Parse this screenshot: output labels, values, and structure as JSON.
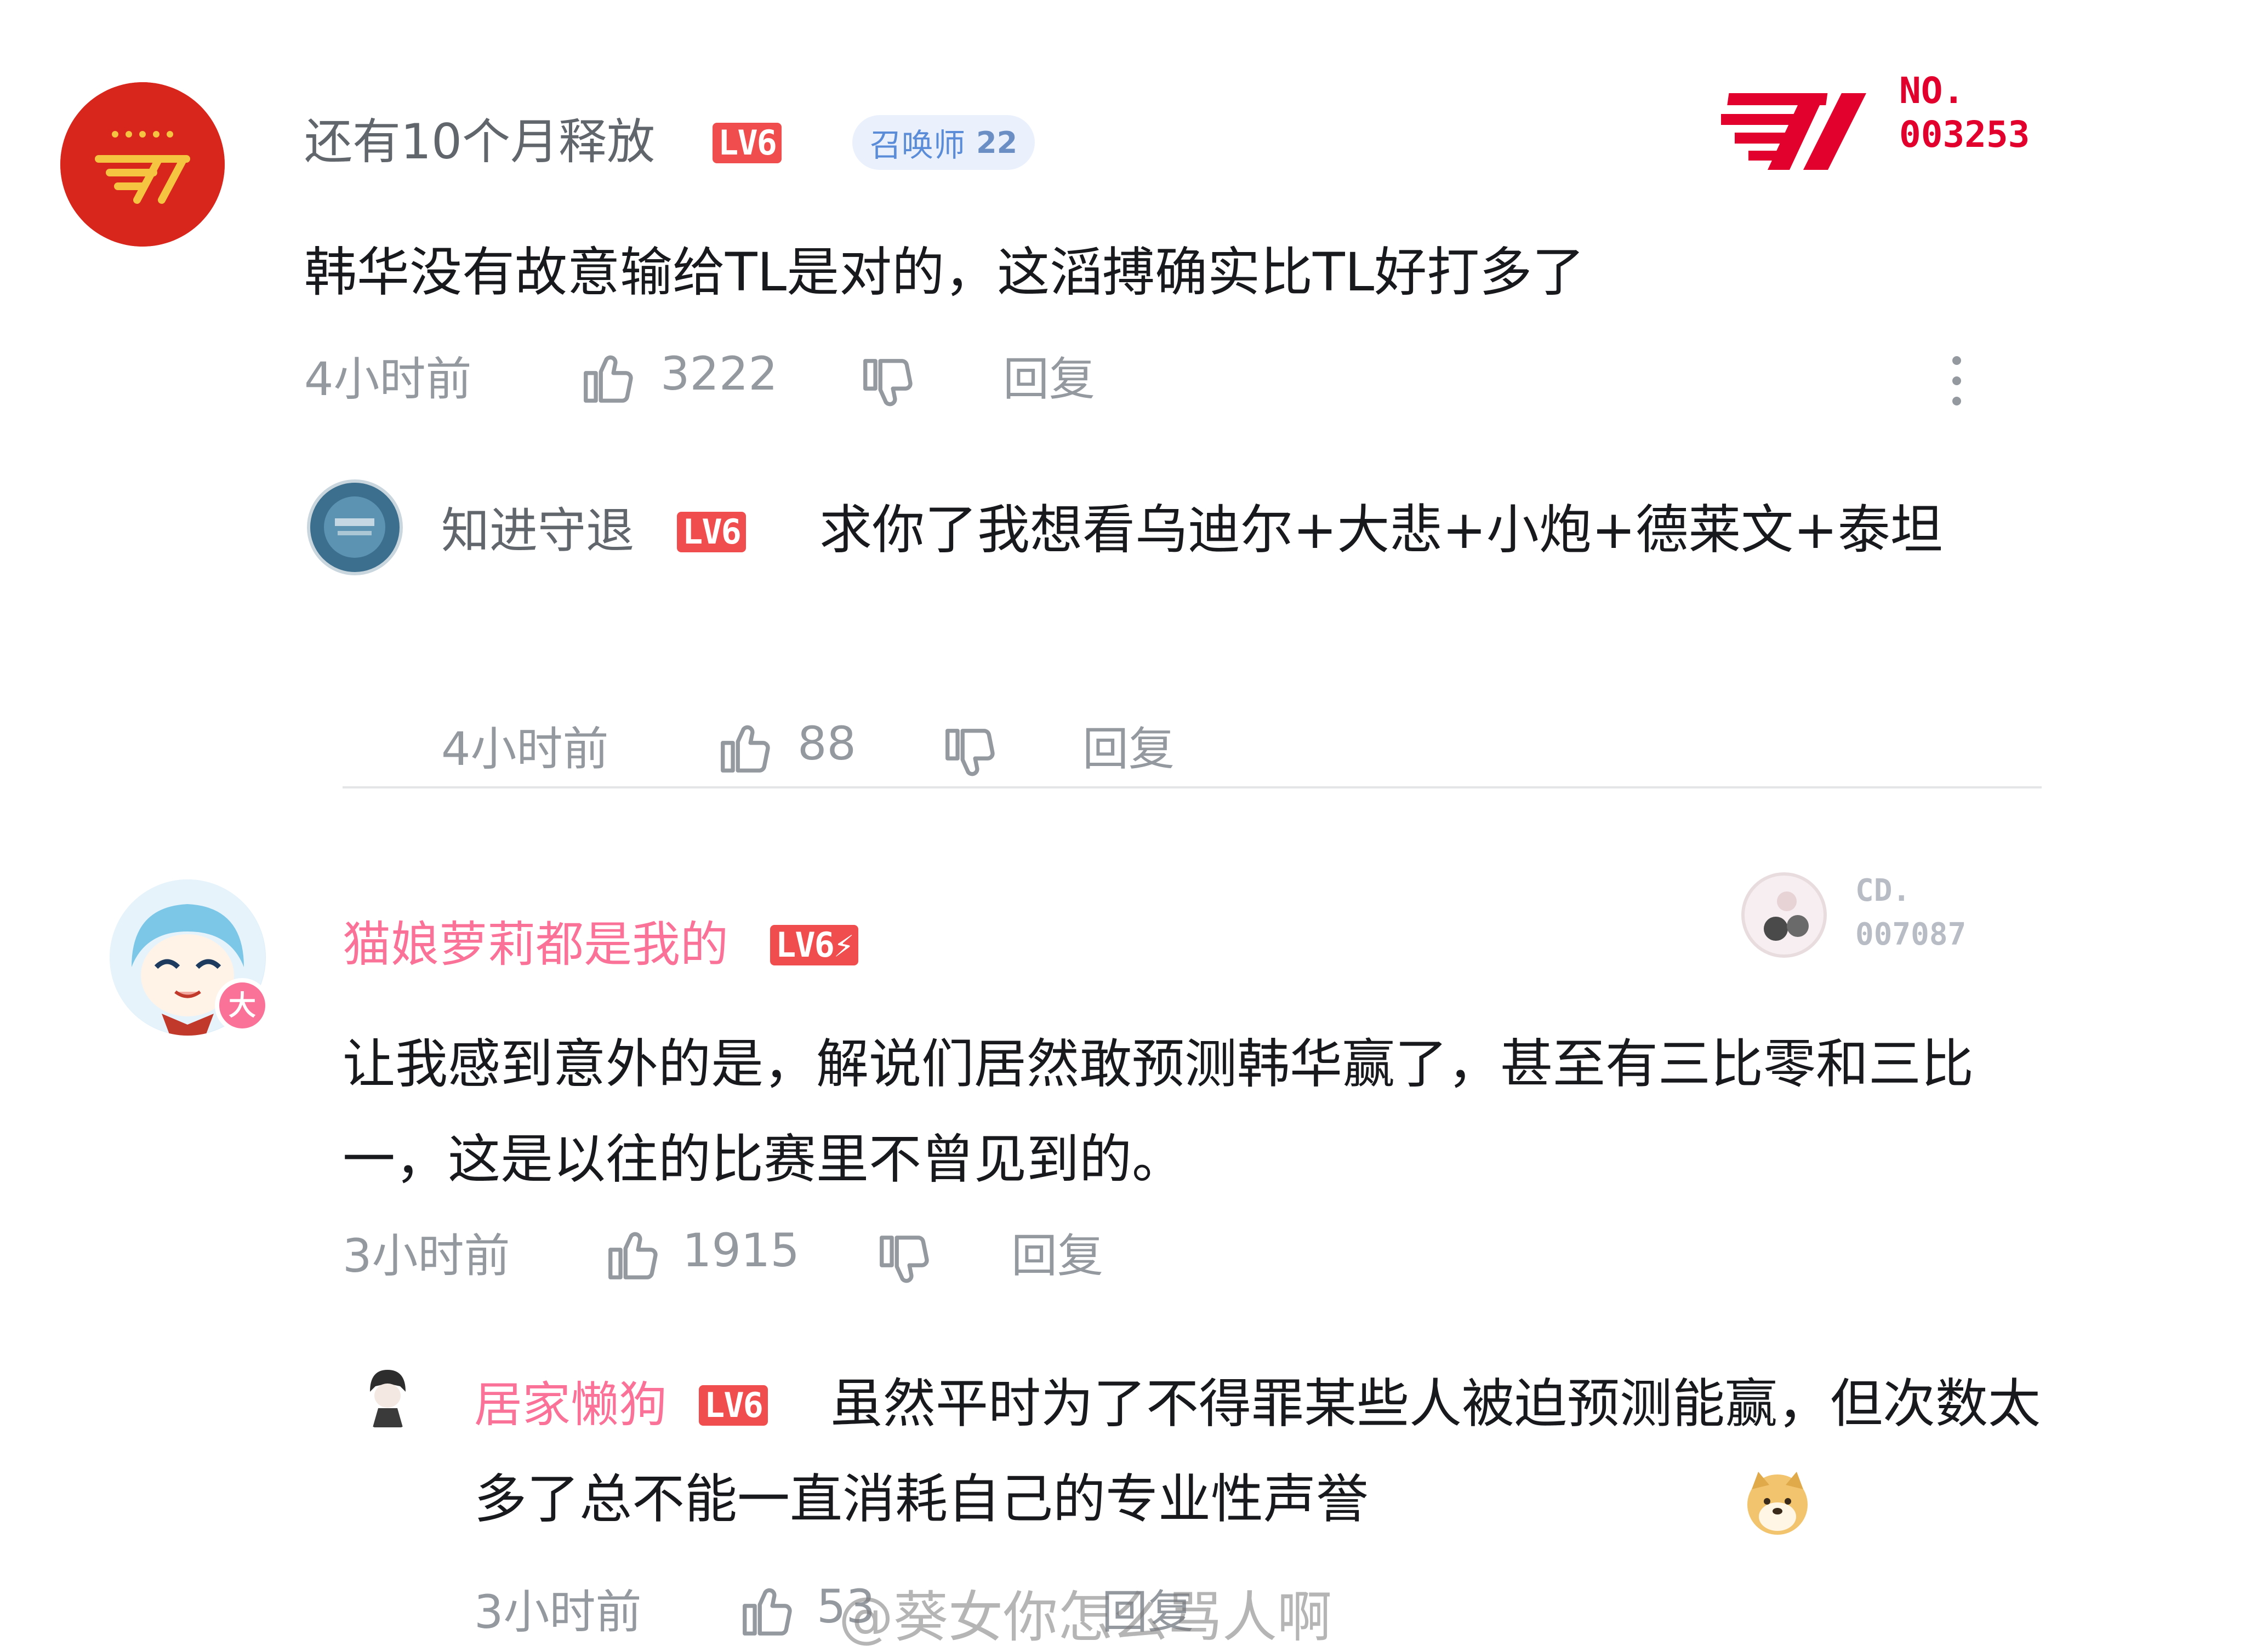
{
  "comments": [
    {
      "username": "还有10个月释放",
      "level": "LV6",
      "badge_label": "召唤师",
      "badge_level": "22",
      "fan_card": {
        "label": "NO.",
        "number": "003253"
      },
      "content": "韩华没有故意输给TL是对的，这滔搏确实比TL好打多了",
      "time": "4小时前",
      "likes": "3222",
      "reply_label": "回复",
      "reply": {
        "username": "知进守退",
        "level": "LV6",
        "content": "求你了我想看乌迪尔+大悲+小炮+德莱文+泰坦",
        "time": "4小时前",
        "likes": "88",
        "reply_label": "回复"
      }
    },
    {
      "username": "猫娘萝莉都是我的",
      "level": "LV6⚡",
      "avatar_badge": "大",
      "fan_card": {
        "label": "CD.",
        "number": "007087"
      },
      "content": "让我感到意外的是，解说们居然敢预测韩华赢了，甚至有三比零和三比一，这是以往的比赛里不曾见到的。",
      "time": "3小时前",
      "likes": "1915",
      "reply_label": "回复",
      "reply": {
        "username": "居家懒狗",
        "level": "LV6",
        "content": "虽然平时为了不得罪某些人被迫预测能赢，但次数太多了总不能一直消耗自己的专业性声誉",
        "time": "3小时前",
        "likes": "53",
        "reply_label": "回复"
      }
    }
  ],
  "watermark": "@葵女你怎么骂人啊",
  "colors": {
    "level_badge": "#f04e4e",
    "pink_name": "#fb7299",
    "gray_text": "#9499a0",
    "t1_red": "#e2012d"
  },
  "icons": [
    "like-icon",
    "dislike-icon",
    "more-icon",
    "doge-emoji"
  ]
}
